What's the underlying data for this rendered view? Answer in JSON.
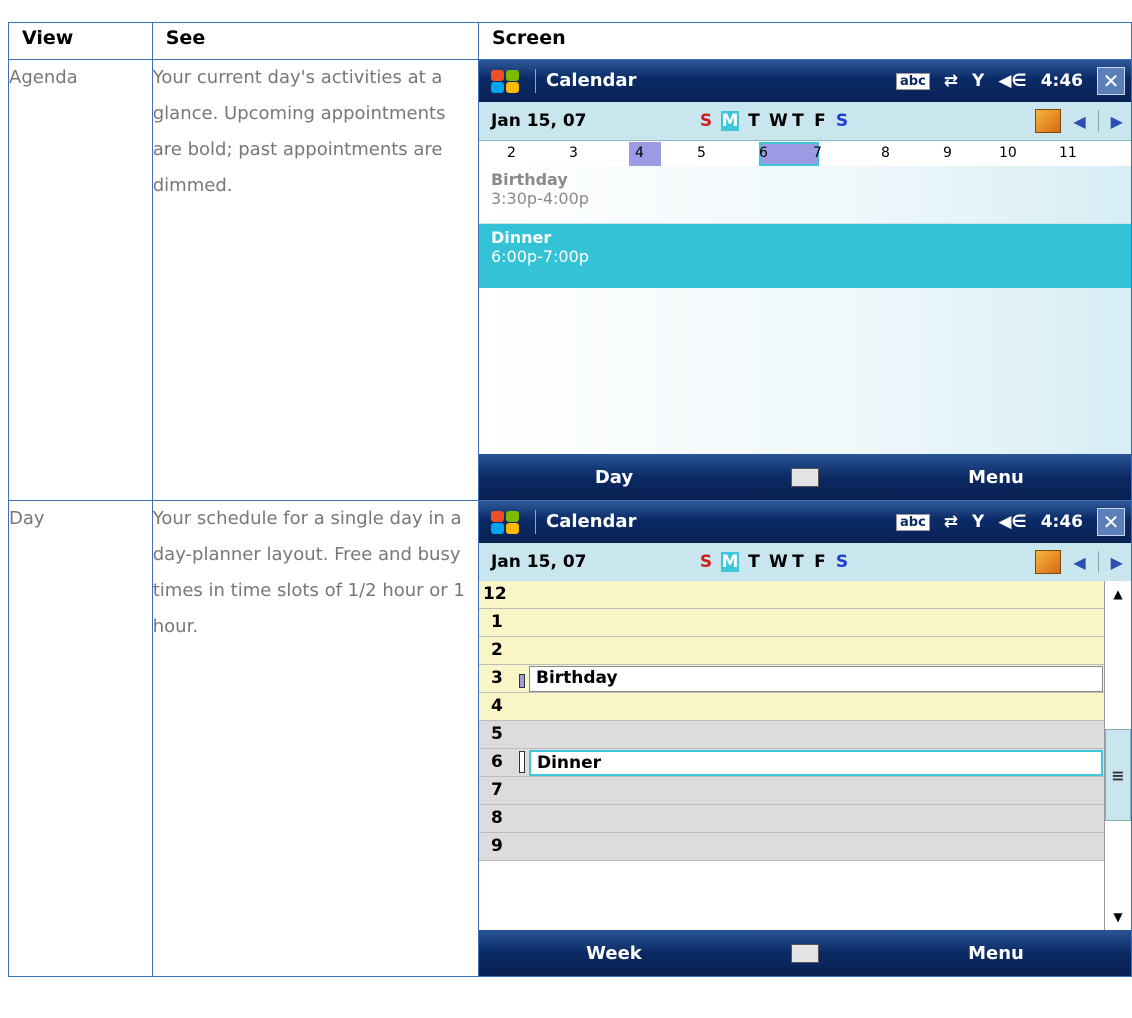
{
  "table": {
    "headers": {
      "view": "View",
      "see": "See",
      "screen": "Screen"
    },
    "rows": [
      {
        "view": "Agenda",
        "see": "Your current day's activities at a glance. Upcoming appointments are bold; past appointments are dimmed.",
        "screen": {
          "title": "Calendar",
          "tray": {
            "abc": "abc",
            "sync": "⇄",
            "signal": "Y",
            "volume": "◀∈",
            "time": "4:46",
            "close": "✕"
          },
          "date": "Jan 15, 07",
          "days": [
            "S",
            "M",
            "T",
            "W",
            "T",
            "F",
            "S"
          ],
          "hours": [
            "2",
            "3",
            "4",
            "5",
            "6",
            "7",
            "8",
            "9",
            "10",
            "11"
          ],
          "appointments": [
            {
              "name": "Birthday",
              "time": "3:30p-4:00p"
            },
            {
              "name": "Dinner",
              "time": "6:00p-7:00p"
            }
          ],
          "softkeys": {
            "left": "Day",
            "right": "Menu"
          }
        }
      },
      {
        "view": "Day",
        "see": "Your schedule for a single day in a day-planner layout. Free and busy times in time slots of 1/2 hour or 1 hour.",
        "screen": {
          "title": "Calendar",
          "tray": {
            "abc": "abc",
            "sync": "⇄",
            "signal": "Y",
            "volume": "◀∈",
            "time": "4:46",
            "close": "✕"
          },
          "date": "Jan 15, 07",
          "days": [
            "S",
            "M",
            "T",
            "W",
            "T",
            "F",
            "S"
          ],
          "hours": [
            "12",
            "1",
            "2",
            "3",
            "4",
            "5",
            "6",
            "7",
            "8",
            "9"
          ],
          "events": [
            {
              "hour": "3",
              "name": "Birthday"
            },
            {
              "hour": "6",
              "name": "Dinner"
            }
          ],
          "softkeys": {
            "left": "Week",
            "right": "Menu"
          }
        }
      }
    ]
  }
}
